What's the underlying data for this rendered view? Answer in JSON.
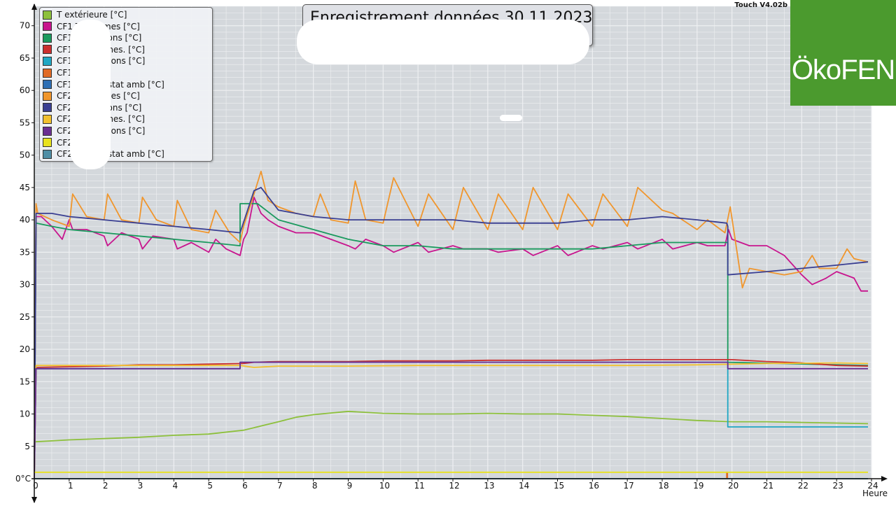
{
  "app": {
    "title": "Enregistrement données  30.11.2023",
    "version": "Touch V4.02b",
    "logo": "ÖkoFEN",
    "x_axis_label": "Heure",
    "y_zero_label": "0°C"
  },
  "colors": {
    "plot_bg": "#d4d8dc",
    "grid": "#eef0f2",
    "logo_bg": "#4b9a2e"
  },
  "legend": [
    {
      "label": "T extérieure [°C]",
      "color": "#8dc03c"
    },
    {
      "label": "CF1 T Dep mes [°C]",
      "color": "#c8158e"
    },
    {
      "label": "CF1 T Dep cons [°C]",
      "color": "#1a9a5e"
    },
    {
      "label": "CF1 T Amb mes. [°C]",
      "color": "#cc2e2e"
    },
    {
      "label": "CF1 T Amb Cons [°C]",
      "color": "#1fa7c4"
    },
    {
      "label": "CF1 Pompe",
      "color": "#e06a25"
    },
    {
      "label": "CF1 Thermostat amb [°C]",
      "color": "#2e6fb5"
    },
    {
      "label": "CF2 T Dep mes [°C]",
      "color": "#f0962d"
    },
    {
      "label": "CF2 T Dep cons [°C]",
      "color": "#3a3f92"
    },
    {
      "label": "CF2 T Amb mes. [°C]",
      "color": "#f2c12e"
    },
    {
      "label": "CF2 T Amb Cons [°C]",
      "color": "#6a2e92"
    },
    {
      "label": "CF2 Pompe",
      "color": "#e8e21e"
    },
    {
      "label": "CF2 Thermostat amb [°C]",
      "color": "#4f8ea6"
    }
  ],
  "chart_data": {
    "type": "line",
    "title": "Enregistrement données  30.11.2023",
    "xlabel": "Heure",
    "ylabel": "",
    "xlim": [
      0,
      24
    ],
    "ylim": [
      0,
      73
    ],
    "x_ticks": [
      0,
      1,
      2,
      3,
      4,
      5,
      6,
      7,
      8,
      9,
      10,
      11,
      12,
      13,
      14,
      15,
      16,
      17,
      18,
      19,
      20,
      21,
      22,
      23,
      24
    ],
    "y_ticks": [
      5,
      10,
      15,
      20,
      25,
      30,
      35,
      40,
      45,
      50,
      55,
      60,
      65,
      70
    ],
    "grid": true,
    "legend_position": "top-left",
    "series": [
      {
        "name": "T extérieure [°C]",
        "color": "#8dc03c",
        "x": [
          0,
          1,
          2,
          3,
          4,
          5,
          6,
          7,
          7.5,
          8,
          9,
          10,
          11,
          12,
          13,
          14,
          15,
          16,
          17,
          18,
          19,
          20,
          21,
          22,
          23,
          23.9
        ],
        "y": [
          5.7,
          6.0,
          6.2,
          6.4,
          6.7,
          6.9,
          7.5,
          8.8,
          9.5,
          9.9,
          10.4,
          10.1,
          10.0,
          10.0,
          10.1,
          10.0,
          10.0,
          9.8,
          9.6,
          9.3,
          9.0,
          8.8,
          8.8,
          8.7,
          8.6,
          8.5
        ]
      },
      {
        "name": "CF1 T Dep mes [°C]",
        "color": "#c8158e",
        "x": [
          0,
          0.05,
          0.2,
          0.5,
          0.8,
          1.0,
          1.1,
          1.5,
          2.0,
          2.1,
          2.5,
          3.0,
          3.1,
          3.4,
          4.0,
          4.1,
          4.5,
          5.0,
          5.2,
          5.5,
          5.9,
          6.0,
          6.1,
          6.3,
          6.5,
          6.7,
          7.0,
          7.5,
          8.0,
          8.5,
          9.0,
          9.2,
          9.5,
          10.0,
          10.3,
          11.0,
          11.3,
          12.0,
          12.3,
          13.0,
          13.3,
          14.0,
          14.3,
          15.0,
          15.3,
          16.0,
          16.3,
          17.0,
          17.3,
          18.0,
          18.3,
          19.0,
          19.3,
          19.8,
          19.9,
          20.0,
          20.5,
          21.0,
          21.5,
          22.0,
          22.3,
          22.7,
          23.0,
          23.5,
          23.7,
          23.9
        ],
        "y": [
          0,
          40.5,
          40.5,
          39.0,
          37.0,
          40.0,
          38.5,
          38.5,
          37.5,
          36.0,
          38.0,
          37.0,
          35.5,
          37.5,
          37.0,
          35.5,
          36.5,
          35.0,
          37.0,
          35.5,
          34.5,
          37.0,
          38.0,
          43.5,
          41.0,
          40.0,
          39.0,
          38.0,
          38.0,
          37.0,
          36.0,
          35.5,
          37.0,
          36.0,
          35.0,
          36.5,
          35.0,
          36.0,
          35.5,
          35.5,
          35.0,
          35.5,
          34.5,
          36.0,
          34.5,
          36.0,
          35.5,
          36.5,
          35.5,
          37.0,
          35.5,
          36.5,
          36.0,
          36.0,
          38.5,
          37.0,
          36.0,
          36.0,
          34.5,
          31.5,
          30.0,
          31.0,
          32.0,
          31.0,
          29.0,
          29.0
        ]
      },
      {
        "name": "CF1 T Dep cons [°C]",
        "color": "#1a9a5e",
        "x": [
          0,
          0.05,
          0.5,
          1,
          2,
          3,
          4,
          5,
          5.9,
          5.9,
          6.4,
          7,
          8,
          9,
          10,
          11,
          12,
          13,
          14,
          15,
          16,
          17,
          18,
          19,
          19.85,
          19.88,
          19.88,
          23.9
        ],
        "y": [
          0,
          39.5,
          39.0,
          38.5,
          38.0,
          37.5,
          37.0,
          36.5,
          36.0,
          42.5,
          42.5,
          40.0,
          38.5,
          37.0,
          36.0,
          36.0,
          35.5,
          35.5,
          35.5,
          35.5,
          35.5,
          36.0,
          36.5,
          36.5,
          36.5,
          36.5,
          18.0,
          17.5
        ]
      },
      {
        "name": "CF1 T Amb mes. [°C]",
        "color": "#cc2e2e",
        "x": [
          0,
          0.05,
          1,
          2,
          3,
          4,
          5,
          6,
          6.3,
          7,
          8,
          9,
          10,
          11,
          12,
          13,
          14,
          15,
          16,
          17,
          18,
          19,
          20,
          21,
          22,
          23,
          23.9
        ],
        "y": [
          0,
          17.2,
          17.3,
          17.4,
          17.6,
          17.6,
          17.7,
          17.8,
          18.0,
          18.1,
          18.1,
          18.1,
          18.2,
          18.2,
          18.2,
          18.3,
          18.3,
          18.3,
          18.3,
          18.4,
          18.4,
          18.4,
          18.4,
          18.1,
          17.9,
          17.5,
          17.4
        ]
      },
      {
        "name": "CF1 T Amb Cons [°C]",
        "color": "#1fa7c4",
        "x": [
          0,
          0.05,
          5.9,
          5.9,
          19.85,
          19.88,
          19.88,
          23.9
        ],
        "y": [
          0,
          17.0,
          17.0,
          18.0,
          18.0,
          18.0,
          8.0,
          8.0
        ]
      },
      {
        "name": "CF1 Pompe",
        "color": "#e06a25",
        "x": [
          0,
          19.85,
          19.85,
          19.87,
          19.87,
          23.9
        ],
        "y": [
          0,
          0,
          1,
          1,
          0,
          0
        ]
      },
      {
        "name": "CF1 Thermostat amb [°C]",
        "color": "#2e6fb5",
        "x": [
          0,
          23.9
        ],
        "y": [
          0,
          0
        ]
      },
      {
        "name": "CF2 T Dep mes [°C]",
        "color": "#f0962d",
        "x": [
          0,
          0.05,
          0.1,
          0.5,
          1.0,
          1.1,
          1.5,
          2.0,
          2.1,
          2.5,
          3.0,
          3.1,
          3.5,
          4.0,
          4.1,
          4.5,
          5.0,
          5.2,
          5.6,
          5.9,
          6.0,
          6.3,
          6.5,
          6.7,
          7.0,
          7.5,
          8.0,
          8.2,
          8.5,
          9.0,
          9.2,
          9.5,
          10.0,
          10.3,
          11.0,
          11.3,
          12.0,
          12.3,
          13.0,
          13.3,
          14.0,
          14.3,
          15.0,
          15.3,
          16.0,
          16.3,
          17.0,
          17.3,
          18.0,
          18.3,
          19.0,
          19.3,
          19.8,
          19.95,
          20.3,
          20.5,
          21.0,
          21.5,
          22.0,
          22.3,
          22.5,
          23.0,
          23.3,
          23.5,
          23.9
        ],
        "y": [
          0,
          42.5,
          41.0,
          40.0,
          39.0,
          44.0,
          40.5,
          40.0,
          44.0,
          40.0,
          39.5,
          43.5,
          40.0,
          39.0,
          43.0,
          38.5,
          38.0,
          41.5,
          38.0,
          36.5,
          39.0,
          44.0,
          47.5,
          43.0,
          42.0,
          41.0,
          40.5,
          44.0,
          40.0,
          39.5,
          46.0,
          40.0,
          39.5,
          46.5,
          39.0,
          44.0,
          38.5,
          45.0,
          38.5,
          44.0,
          38.5,
          45.0,
          38.5,
          44.0,
          39.0,
          44.0,
          39.0,
          45.0,
          41.5,
          41.0,
          38.5,
          40.0,
          38.0,
          42.0,
          29.5,
          32.5,
          32.0,
          31.5,
          32.0,
          34.5,
          32.5,
          32.5,
          35.5,
          34.0,
          33.5
        ]
      },
      {
        "name": "CF2 T Dep cons [°C]",
        "color": "#3a3f92",
        "x": [
          0,
          0.05,
          0.5,
          1,
          2,
          3,
          4,
          5,
          5.9,
          6.3,
          6.5,
          7,
          8,
          9,
          10,
          11,
          12,
          13,
          14,
          15,
          16,
          17,
          18,
          19,
          19.85,
          19.88,
          19.88,
          21,
          22,
          23,
          23.9
        ],
        "y": [
          0,
          41.0,
          41.0,
          40.5,
          40.0,
          39.5,
          39.0,
          38.5,
          38.0,
          44.5,
          45.0,
          41.5,
          40.5,
          40.0,
          40.0,
          40.0,
          40.0,
          39.5,
          39.5,
          39.5,
          40.0,
          40.0,
          40.5,
          40.0,
          39.5,
          39.0,
          31.5,
          32.0,
          32.5,
          33.0,
          33.5
        ]
      },
      {
        "name": "CF2 T Amb mes. [°C]",
        "color": "#f2c12e",
        "x": [
          0,
          0.05,
          2,
          4,
          5.9,
          6.3,
          7,
          9,
          11,
          13,
          15,
          17,
          19,
          21,
          23,
          23.9
        ],
        "y": [
          0,
          17.5,
          17.5,
          17.5,
          17.5,
          17.2,
          17.4,
          17.4,
          17.5,
          17.5,
          17.5,
          17.5,
          17.6,
          17.8,
          17.9,
          17.8
        ]
      },
      {
        "name": "CF2 T Amb Cons [°C]",
        "color": "#6a2e92",
        "x": [
          0,
          0.05,
          5.9,
          5.9,
          19.85,
          19.88,
          19.88,
          23.9
        ],
        "y": [
          0,
          17.0,
          17.0,
          18.0,
          18.0,
          18.0,
          17.0,
          17.0
        ]
      },
      {
        "name": "CF2 Pompe",
        "color": "#e8e21e",
        "x": [
          0,
          0.05,
          23.9
        ],
        "y": [
          1,
          1,
          1
        ]
      },
      {
        "name": "CF2 Thermostat amb [°C]",
        "color": "#4f8ea6",
        "x": [
          0,
          23.9
        ],
        "y": [
          0,
          0
        ]
      }
    ]
  }
}
